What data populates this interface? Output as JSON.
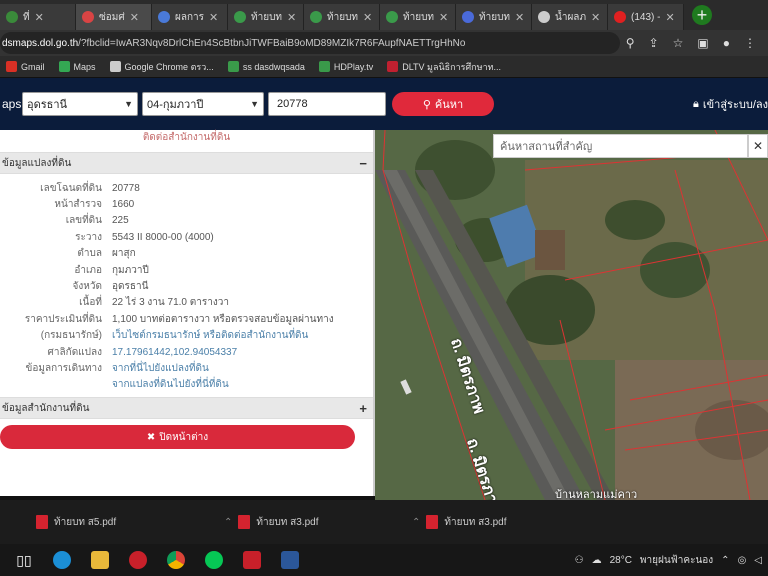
{
  "browser": {
    "tabs": [
      {
        "label": "ที่",
        "color": "#3a8a3a",
        "active": false
      },
      {
        "label": "ซ่อมศ่",
        "color": "#d94444",
        "active": true
      },
      {
        "label": "ผลการ",
        "color": "#4a7ad9",
        "active": false
      },
      {
        "label": "ท้ายบท",
        "color": "#3a9a4a",
        "active": false
      },
      {
        "label": "ท้ายบท",
        "color": "#3a9a4a",
        "active": false
      },
      {
        "label": "ท้ายบท",
        "color": "#3a9a4a",
        "active": false
      },
      {
        "label": "ท้ายบท",
        "color": "#4a6ad9",
        "active": false
      },
      {
        "label": "น้ำผลภ",
        "color": "#cccccc",
        "active": false
      },
      {
        "label": "(143) -",
        "color": "#e02020",
        "active": false
      }
    ],
    "new_tab": "+",
    "url_host": "dsmaps.dol.go.th",
    "url_rest": "/?fbclid=IwAR3Nqv8DrlChEn4ScBtbnJiTWFBaiB9oMD89MZIk7R6FAupfNAETTrgHhNo",
    "bookmarks": [
      {
        "label": "Gmail",
        "color": "#d93025"
      },
      {
        "label": "Maps",
        "color": "#34a853"
      },
      {
        "label": "Google Chrome ตรว...",
        "color": "#cccccc"
      },
      {
        "label": "ss dasdwqsada",
        "color": "#3a9a4a"
      },
      {
        "label": "HDPlay.tv",
        "color": "#3a9a4a"
      },
      {
        "label": "DLTV มูลนิธิการศึกษาท...",
        "color": "#c02030"
      }
    ]
  },
  "header": {
    "brand": "aps",
    "province": "อุดรธานี",
    "district": "04-กุมภวาปี",
    "parcel_number": "20778",
    "search_label": "ค้นหา",
    "login_label": "เข้าสู่ระบบ/ลง"
  },
  "panel": {
    "contact_top": "ติดต่อสำนักงานที่ดิน",
    "section_parcel": "ข้อมูลแปลงที่ดิน",
    "section_parcel_toggle": "−",
    "rows": [
      {
        "key": "เลขโฉนดที่ดิน",
        "value": "20778",
        "link": false
      },
      {
        "key": "หน้าสำรวจ",
        "value": "1660",
        "link": false
      },
      {
        "key": "เลขที่ดิน",
        "value": "225",
        "link": false
      },
      {
        "key": "ระวาง",
        "value": "5543 II 8000-00 (4000)",
        "link": false
      },
      {
        "key": "ตำบล",
        "value": "ผาสุก",
        "link": false
      },
      {
        "key": "อำเภอ",
        "value": "กุมภวาปี",
        "link": false
      },
      {
        "key": "จังหวัด",
        "value": "อุดรธานี",
        "link": false
      },
      {
        "key": "เนื้อที่",
        "value": "22 ไร่ 3 งาน 71.0 ตารางวา",
        "link": false
      },
      {
        "key": "ราคาประเมินที่ดิน",
        "value": "1,100 บาทต่อตารางวา หรือตรวจสอบข้อมูลผ่านทาง",
        "link": false
      },
      {
        "key": "(กรมธนารักษ์)",
        "value": "เว็บไซต์กรมธนารักษ์ หรือติดต่อสำนักงานที่ดิน",
        "link": true
      },
      {
        "key": "ศาลิกัดแปลง",
        "value": "17.17961442,102.94054337",
        "link": true
      },
      {
        "key": "ข้อมูลการเดินทาง",
        "value": "จากที่นี่ไปยังแปลงที่ดิน",
        "link": true
      },
      {
        "key": "",
        "value": "จากแปลงที่ดินไปยังที่นี่ที่ดิน",
        "link": true
      }
    ],
    "section_office": "ข้อมูลสำนักงานที่ดิน",
    "section_office_toggle": "+",
    "close_label": "ปิดหน้าต่าง"
  },
  "map": {
    "search_placeholder": "ค้นหาสถานที่สำคัญ",
    "close": "✕",
    "road_label_1": "ถ. มิตรภาพ",
    "road_label_2": "ถ. มิตรภา",
    "place_label": "บ้านหลามแม่คาว"
  },
  "downloads": [
    {
      "label": "ท้ายบท ส5.pdf"
    },
    {
      "label": "ท้ายบท ส3.pdf"
    },
    {
      "label": "ท้ายบท ส3.pdf"
    }
  ],
  "taskbar": {
    "temperature": "28°C",
    "weather": "พายุฝนฟ้าคะนอง"
  }
}
